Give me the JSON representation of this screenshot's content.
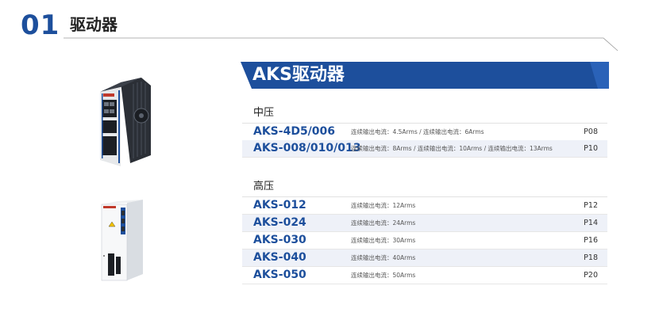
{
  "section": {
    "number": "01",
    "title": "驱动器"
  },
  "banner": {
    "title": "AKS驱动器"
  },
  "groups": [
    {
      "label": "中压",
      "rows": [
        {
          "model": "AKS-4D5/006",
          "spec": "连续输出电流：4.5Arms / 连续输出电流：6Arms",
          "page": "P08"
        },
        {
          "model": "AKS-008/010/013",
          "spec": "连续输出电流：8Arms  /  连续输出电流：10Arms  /  连续输出电流：13Arms",
          "page": "P10"
        }
      ]
    },
    {
      "label": "高压",
      "rows": [
        {
          "model": "AKS-012",
          "spec": "连续输出电流：12Arms",
          "page": "P12"
        },
        {
          "model": "AKS-024",
          "spec": "连续输出电流：24Arms",
          "page": "P14"
        },
        {
          "model": "AKS-030",
          "spec": "连续输出电流：30Arms",
          "page": "P16"
        },
        {
          "model": "AKS-040",
          "spec": "连续输出电流：40Arms",
          "page": "P18"
        },
        {
          "model": "AKS-050",
          "spec": "连续输出电流：50Arms",
          "page": "P20"
        }
      ]
    }
  ],
  "colors": {
    "brand_blue": "#1d4f9c",
    "row_shade": "#eef1f8"
  }
}
